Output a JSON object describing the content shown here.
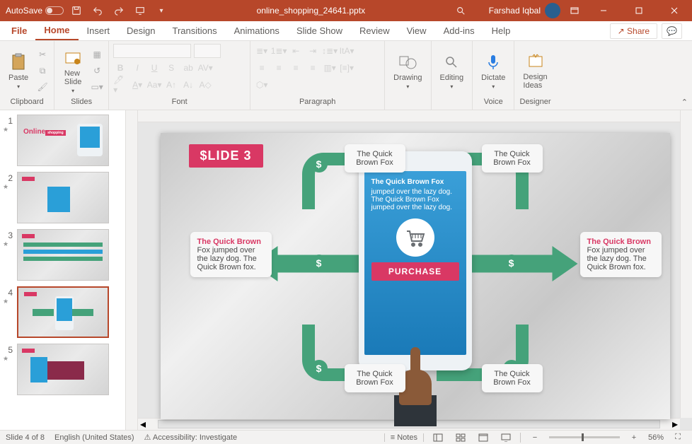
{
  "titlebar": {
    "autosave_label": "AutoSave",
    "autosave_state": "Off",
    "filename": "online_shopping_24641.pptx",
    "user_name": "Farshad Iqbal"
  },
  "tabs": {
    "file": "File",
    "home": "Home",
    "insert": "Insert",
    "design": "Design",
    "transitions": "Transitions",
    "animations": "Animations",
    "slideshow": "Slide Show",
    "review": "Review",
    "view": "View",
    "addins": "Add-ins",
    "help": "Help",
    "share": "Share"
  },
  "ribbon": {
    "clipboard": {
      "label": "Clipboard",
      "paste": "Paste"
    },
    "slides": {
      "label": "Slides",
      "newslide": "New\nSlide"
    },
    "font": {
      "label": "Font"
    },
    "paragraph": {
      "label": "Paragraph"
    },
    "drawing": {
      "label": "Drawing"
    },
    "editing": {
      "label": "Editing"
    },
    "voice": {
      "label": "Voice",
      "dictate": "Dictate"
    },
    "designer": {
      "label": "Designer",
      "ideas": "Design\nIdeas"
    }
  },
  "thumbnails": [
    {
      "num": "1",
      "title": "Online shopping"
    },
    {
      "num": "2",
      "title": ""
    },
    {
      "num": "3",
      "title": ""
    },
    {
      "num": "4",
      "title": ""
    },
    {
      "num": "5",
      "title": ""
    }
  ],
  "slide": {
    "badge": "$LIDE 3",
    "phone_title": "The Quick Brown Fox",
    "phone_body": "jumped over the lazy dog. The Quick Brown Fox jumped over the lazy dog.",
    "purchase": "PURCHASE",
    "callout_small": "The Quick Brown Fox",
    "callout_big_title": "The Quick Brown",
    "callout_big_body": "Fox jumped over the lazy dog. The Quick Brown fox."
  },
  "statusbar": {
    "slide_of": "Slide 4 of 8",
    "language": "English (United States)",
    "accessibility": "Accessibility: Investigate",
    "notes": "Notes",
    "zoom": "56%"
  }
}
